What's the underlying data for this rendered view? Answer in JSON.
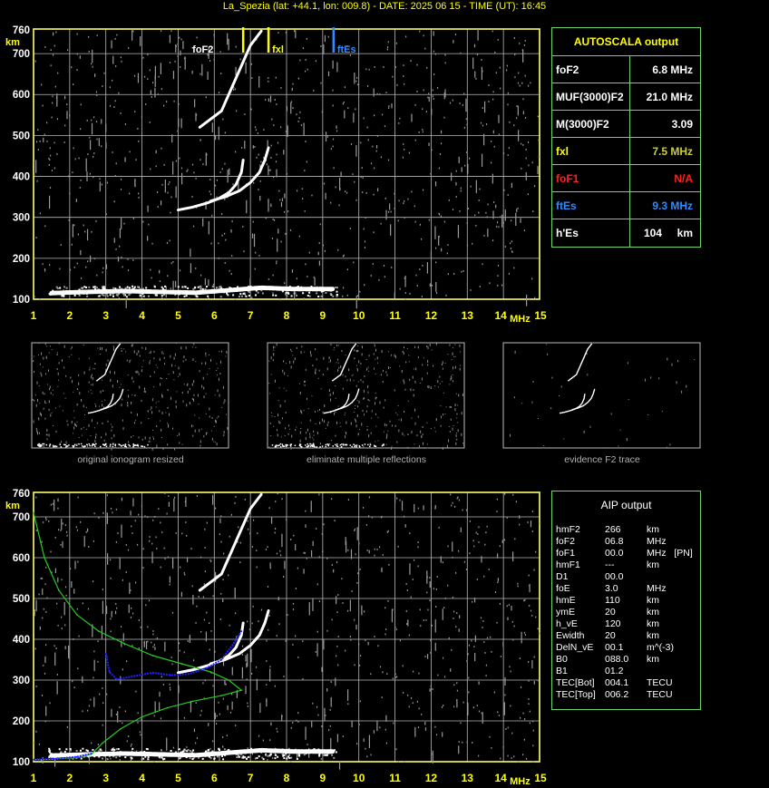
{
  "header": {
    "title": "La_Spezia (lat: +44.1, lon: 009.8) - DATE: 2025 06 15 - TIME (UT): 16:45"
  },
  "colors": {
    "yellow": "#ffff00",
    "grid": "#b8b8b8",
    "frame": "#ffff66",
    "panel_border": "#6fd46f",
    "trace": "#ffffff",
    "noise": "#9a9a9a",
    "red": "#ff2020",
    "blue": "#2f8cff",
    "green_profile": "#22cc22",
    "blue_profile": "#2020ff"
  },
  "chart_data": [
    {
      "type": "scatter",
      "name_key": "main-ionogram",
      "ylabel": "km",
      "xlabel": "MHz",
      "xlim": [
        1,
        15
      ],
      "ylim": [
        100,
        760
      ],
      "x_ticks": [
        1,
        2,
        3,
        4,
        5,
        6,
        7,
        8,
        9,
        10,
        11,
        12,
        13,
        14,
        15
      ],
      "y_ticks": [
        100,
        200,
        300,
        400,
        500,
        600,
        700,
        760
      ],
      "grid": true,
      "markers": [
        {
          "label": "foF2",
          "x": 6.8,
          "color": "#ffffff"
        },
        {
          "label": "fxl",
          "x": 7.5,
          "color": "#ffff00"
        },
        {
          "label": "ftEs",
          "x": 9.3,
          "color": "#2f8cff"
        }
      ],
      "traces": [
        {
          "label": "o-trace",
          "points": [
            [
              5.0,
              318
            ],
            [
              5.4,
              325
            ],
            [
              5.8,
              335
            ],
            [
              6.1,
              345
            ],
            [
              6.4,
              360
            ],
            [
              6.6,
              380
            ],
            [
              6.75,
              410
            ],
            [
              6.8,
              440
            ]
          ]
        },
        {
          "label": "x-trace",
          "points": [
            [
              5.9,
              340
            ],
            [
              6.3,
              350
            ],
            [
              6.7,
              365
            ],
            [
              7.0,
              385
            ],
            [
              7.25,
              410
            ],
            [
              7.4,
              440
            ],
            [
              7.5,
              470
            ]
          ]
        },
        {
          "label": "o-trace-2nd",
          "points": [
            [
              5.6,
              520
            ],
            [
              6.2,
              560
            ],
            [
              6.6,
              640
            ],
            [
              6.8,
              680
            ],
            [
              7.0,
              720
            ],
            [
              7.3,
              755
            ]
          ]
        },
        {
          "label": "Es-layer",
          "points": [
            [
              1.5,
              115
            ],
            [
              2.5,
              118
            ],
            [
              3.5,
              120
            ],
            [
              4.5,
              118
            ],
            [
              5.5,
              116
            ],
            [
              7.3,
              128
            ],
            [
              8.2,
              125
            ],
            [
              9.3,
              125
            ]
          ]
        }
      ]
    },
    {
      "type": "scatter",
      "name_key": "aip-ionogram",
      "ylabel": "km",
      "xlabel": "MHz",
      "xlim": [
        1,
        15
      ],
      "ylim": [
        100,
        760
      ],
      "x_ticks": [
        1,
        2,
        3,
        4,
        5,
        6,
        7,
        8,
        9,
        10,
        11,
        12,
        13,
        14,
        15
      ],
      "y_ticks": [
        100,
        200,
        300,
        400,
        500,
        600,
        700,
        760
      ],
      "grid": true,
      "series": [
        {
          "label": "electron-density-profile",
          "color": "#22cc22",
          "points": [
            [
              1.0,
              710
            ],
            [
              1.3,
              600
            ],
            [
              1.7,
              520
            ],
            [
              2.2,
              460
            ],
            [
              2.8,
              420
            ],
            [
              3.5,
              390
            ],
            [
              4.3,
              360
            ],
            [
              5.1,
              340
            ],
            [
              5.9,
              320
            ],
            [
              6.4,
              300
            ],
            [
              6.75,
              275
            ],
            [
              6.2,
              262
            ],
            [
              5.4,
              248
            ],
            [
              4.7,
              232
            ],
            [
              4.0,
              210
            ],
            [
              3.4,
              180
            ],
            [
              2.9,
              145
            ],
            [
              2.6,
              118
            ],
            [
              2.2,
              110
            ],
            [
              1.5,
              106
            ],
            [
              1.0,
              105
            ]
          ]
        },
        {
          "label": "fitted-trace",
          "color": "#2020ff",
          "points": [
            [
              3.0,
              365
            ],
            [
              3.1,
              320
            ],
            [
              3.3,
              302
            ],
            [
              3.8,
              310
            ],
            [
              4.3,
              318
            ],
            [
              4.8,
              312
            ],
            [
              5.3,
              315
            ],
            [
              5.8,
              330
            ],
            [
              6.2,
              350
            ],
            [
              6.5,
              385
            ],
            [
              6.75,
              420
            ]
          ]
        },
        {
          "label": "fitted-Es",
          "color": "#2020ff",
          "points": [
            [
              1.0,
              105
            ],
            [
              1.6,
              107
            ],
            [
              2.2,
              112
            ],
            [
              2.6,
              120
            ]
          ]
        }
      ]
    }
  ],
  "autoscala": {
    "title": "AUTOSCALA output",
    "rows": [
      {
        "key": "foF2",
        "value": "6.8 MHz",
        "key_color": "#ffffff",
        "value_color": "#ffffff"
      },
      {
        "key": "MUF(3000)F2",
        "value": "21.0 MHz",
        "key_color": "#ffffff",
        "value_color": "#ffffff"
      },
      {
        "key": "M(3000)F2",
        "value": "3.09",
        "key_color": "#ffffff",
        "value_color": "#ffffff"
      },
      {
        "key": "fxl",
        "value": "7.5 MHz",
        "key_color": "#ffff00",
        "value_color": "#cccc40"
      },
      {
        "key": "foF1",
        "value": "N/A",
        "key_color": "#ff2020",
        "value_color": "#ff2020"
      },
      {
        "key": "ftEs",
        "value": "9.3 MHz",
        "key_color": "#2f8cff",
        "value_color": "#2f8cff"
      },
      {
        "key": "h'Es",
        "value": "104     km",
        "key_color": "#ffffff",
        "value_color": "#ffffff"
      }
    ]
  },
  "thumbnails": [
    {
      "caption": "original ionogram resized"
    },
    {
      "caption": "eliminate multiple reflections"
    },
    {
      "caption": "evidence F2 trace"
    }
  ],
  "aip": {
    "title": "AIP output",
    "rows": [
      {
        "k": "hmF2",
        "v": "266",
        "u": "km"
      },
      {
        "k": "foF2",
        "v": "06.8",
        "u": "MHz"
      },
      {
        "k": "foF1",
        "v": "00.0",
        "u": "MHz   [PN]"
      },
      {
        "k": "hmF1",
        "v": "---",
        "u": "km"
      },
      {
        "k": "D1",
        "v": "00.0",
        "u": ""
      },
      {
        "k": "foE",
        "v": "3.0",
        "u": "MHz"
      },
      {
        "k": "hmE",
        "v": "110",
        "u": "km"
      },
      {
        "k": "ymE",
        "v": "20",
        "u": "km"
      },
      {
        "k": "h_vE",
        "v": "120",
        "u": "km"
      },
      {
        "k": "Ewidth",
        "v": "20",
        "u": "km"
      },
      {
        "k": "DelN_vE",
        "v": "00.1",
        "u": "m^(-3)"
      },
      {
        "k": "B0",
        "v": "088.0",
        "u": "km"
      },
      {
        "k": "B1",
        "v": "01.2",
        "u": ""
      },
      {
        "k": "TEC[Bot]",
        "v": "004.1",
        "u": "TECU"
      },
      {
        "k": "TEC[Top]",
        "v": "006.2",
        "u": "TECU"
      }
    ]
  }
}
